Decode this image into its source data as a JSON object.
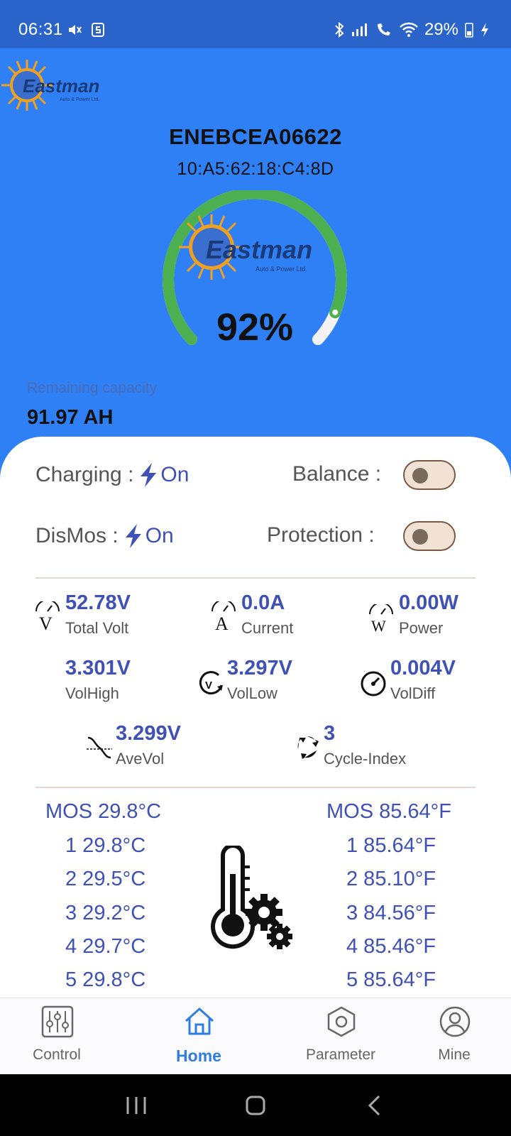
{
  "status_bar": {
    "time": "06:31",
    "battery": "29%"
  },
  "brand": {
    "name": "Eastman",
    "tagline": "Auto & Power Ltd."
  },
  "device": {
    "name": "ENEBCEA06622",
    "mac": "10:A5:62:18:C4:8D"
  },
  "gauge": {
    "percent_text": "92%",
    "percent_value": 92,
    "color": "#4caf50"
  },
  "capacity": {
    "label": "Remaining capacity",
    "value": "91.97 AH"
  },
  "status": {
    "charging_label": "Charging :",
    "charging_value": "On",
    "dismos_label": "DisMos :",
    "dismos_value": "On",
    "balance_label": "Balance :",
    "balance_on": false,
    "protection_label": "Protection :",
    "protection_on": false
  },
  "metrics": {
    "total_volt": {
      "value": "52.78V",
      "label": "Total Volt"
    },
    "current": {
      "value": "0.0A",
      "label": "Current"
    },
    "power": {
      "value": "0.00W",
      "label": "Power"
    },
    "vol_high": {
      "value": "3.301V",
      "label": "VolHigh"
    },
    "vol_low": {
      "value": "3.297V",
      "label": "VolLow"
    },
    "vol_diff": {
      "value": "0.004V",
      "label": "VolDiff"
    },
    "ave_vol": {
      "value": "3.299V",
      "label": "AveVol"
    },
    "cycle_index": {
      "value": "3",
      "label": "Cycle-Index"
    }
  },
  "temps_c": [
    "MOS 29.8°C",
    "1 29.8°C",
    "2 29.5°C",
    "3 29.2°C",
    "4 29.7°C",
    "5 29.8°C"
  ],
  "temps_f": [
    "MOS 85.64°F",
    "1 85.64°F",
    "2 85.10°F",
    "3 84.56°F",
    "4 85.46°F",
    "5 85.64°F"
  ],
  "nav": {
    "control": "Control",
    "home": "Home",
    "parameter": "Parameter",
    "mine": "Mine",
    "active": "home"
  },
  "colors": {
    "primary_blue": "#2f80f5",
    "value_blue": "#3f51b5",
    "gauge_green": "#4caf50",
    "nav_active": "#2f7de0"
  }
}
